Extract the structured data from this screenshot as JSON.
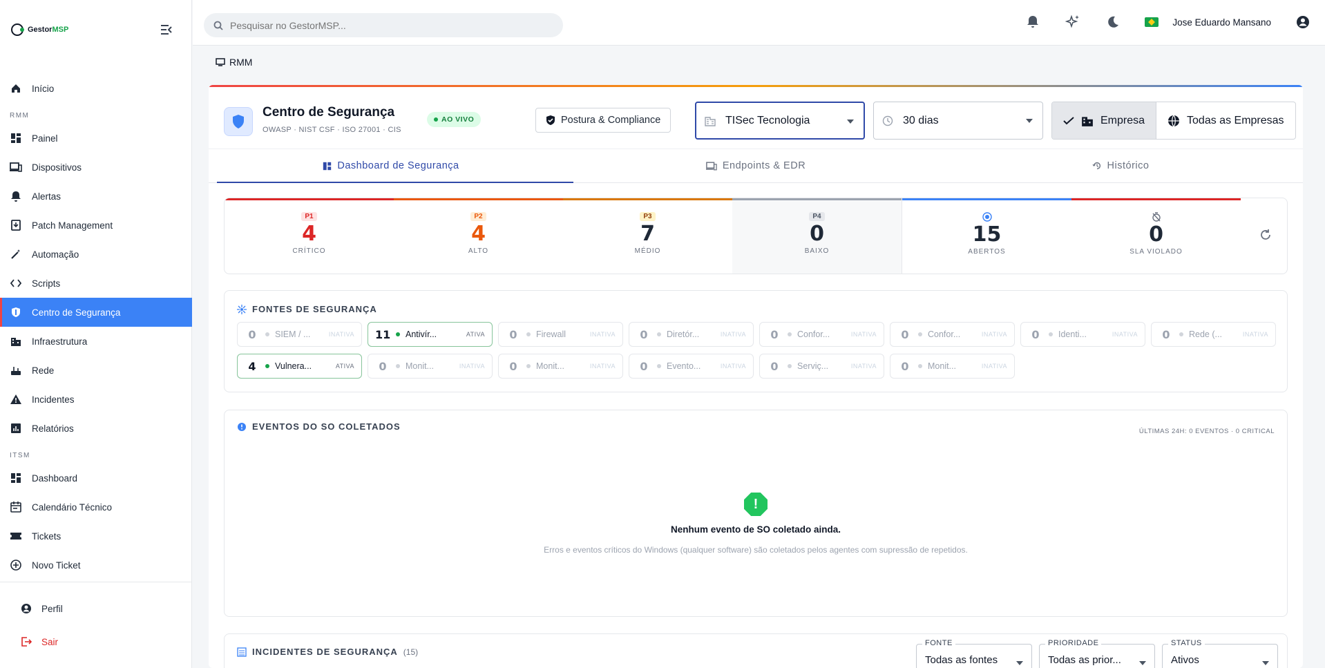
{
  "brand": {
    "name_a": "Gestor",
    "name_b": "MSP"
  },
  "sidebar": {
    "home": "Início",
    "section_rmm": "RMM",
    "rmm_items": [
      {
        "label": "Painel",
        "icon": "dashboard-icon"
      },
      {
        "label": "Dispositivos",
        "icon": "devices-icon"
      },
      {
        "label": "Alertas",
        "icon": "bell-icon"
      },
      {
        "label": "Patch Management",
        "icon": "patch-icon"
      },
      {
        "label": "Automação",
        "icon": "wand-icon"
      },
      {
        "label": "Scripts",
        "icon": "code-icon"
      },
      {
        "label": "Centro de Segurança",
        "icon": "shield-icon"
      },
      {
        "label": "Infraestrutura",
        "icon": "building-icon"
      },
      {
        "label": "Rede",
        "icon": "router-icon"
      },
      {
        "label": "Incidentes",
        "icon": "warning-icon"
      },
      {
        "label": "Relatórios",
        "icon": "chart-icon"
      }
    ],
    "section_itsm": "ITSM",
    "itsm_items": [
      {
        "label": "Dashboard",
        "icon": "dashboard-icon"
      },
      {
        "label": "Calendário Técnico",
        "icon": "calendar-icon"
      },
      {
        "label": "Tickets",
        "icon": "ticket-icon"
      },
      {
        "label": "Novo Ticket",
        "icon": "plus-circle-icon"
      }
    ],
    "profile": "Perfil",
    "logout": "Sair"
  },
  "topbar": {
    "search_placeholder": "Pesquisar no GestorMSP...",
    "user_name": "Jose Eduardo Mansano"
  },
  "breadcrumb": "RMM",
  "header": {
    "title": "Centro de Segurança",
    "subtitle": "OWASP · NIST CSF · ISO 27001 · CIS",
    "live": "AO VIVO",
    "posture_button": "Postura & Compliance",
    "company_select": "TISec Tecnologia",
    "period_select": "30 dias",
    "scope_company": "Empresa",
    "scope_all": "Todas as Empresas"
  },
  "tabs": [
    "Dashboard de Segurança",
    "Endpoints & EDR",
    "Histórico"
  ],
  "stats": [
    {
      "badge": "P1",
      "value": "4",
      "label": "CRÍTICO",
      "color": "#dc2626",
      "badge_bg": "#fee2e2"
    },
    {
      "badge": "P2",
      "value": "4",
      "label": "ALTO",
      "color": "#ea580c",
      "badge_bg": "#ffedd5"
    },
    {
      "badge": "P3",
      "value": "7",
      "label": "MÉDIO",
      "color": "#1f2937",
      "badge_bg": "#fef3c7"
    },
    {
      "badge": "P4",
      "value": "0",
      "label": "BAIXO",
      "color": "#1f2937",
      "badge_bg": "#e5e7eb"
    },
    {
      "value": "15",
      "label": "ABERTOS",
      "color": "#1f2937"
    },
    {
      "value": "0",
      "label": "SLA VIOLADO",
      "color": "#1f2937"
    }
  ],
  "sources": {
    "title": "FONTES DE SEGURANÇA",
    "items": [
      {
        "count": "0",
        "name": "SIEM / ...",
        "status": "INATIVA",
        "active": false
      },
      {
        "count": "11",
        "name": "Antivír...",
        "status": "ATIVA",
        "active": true
      },
      {
        "count": "0",
        "name": "Firewall",
        "status": "INATIVA",
        "active": false
      },
      {
        "count": "0",
        "name": "Diretór...",
        "status": "INATIVA",
        "active": false
      },
      {
        "count": "0",
        "name": "Confor...",
        "status": "INATIVA",
        "active": false
      },
      {
        "count": "0",
        "name": "Confor...",
        "status": "INATIVA",
        "active": false
      },
      {
        "count": "0",
        "name": "Identi...",
        "status": "INATIVA",
        "active": false
      },
      {
        "count": "0",
        "name": "Rede (...",
        "status": "INATIVA",
        "active": false
      },
      {
        "count": "4",
        "name": "Vulnera...",
        "status": "ATIVA",
        "active": true
      },
      {
        "count": "0",
        "name": "Monit...",
        "status": "INATIVA",
        "active": false
      },
      {
        "count": "0",
        "name": "Monit...",
        "status": "INATIVA",
        "active": false
      },
      {
        "count": "0",
        "name": "Evento...",
        "status": "INATIVA",
        "active": false
      },
      {
        "count": "0",
        "name": "Serviç...",
        "status": "INATIVA",
        "active": false
      },
      {
        "count": "0",
        "name": "Monit...",
        "status": "INATIVA",
        "active": false
      }
    ]
  },
  "events": {
    "title": "EVENTOS DO SO COLETADOS",
    "meta": "ÚLTIMAS 24H: 0 EVENTOS · 0 CRITICAL",
    "empty_title": "Nenhum evento de SO coletado ainda.",
    "empty_desc": "Erros e eventos críticos do Windows (qualquer software) são coletados pelos agentes com supressão de repetidos."
  },
  "incidents": {
    "title": "INCIDENTES DE SEGURANÇA",
    "count": "(15)",
    "filters": [
      {
        "label": "FONTE",
        "value": "Todas as fontes"
      },
      {
        "label": "PRIORIDADE",
        "value": "Todas as prior..."
      },
      {
        "label": "STATUS",
        "value": "Ativos"
      }
    ]
  }
}
